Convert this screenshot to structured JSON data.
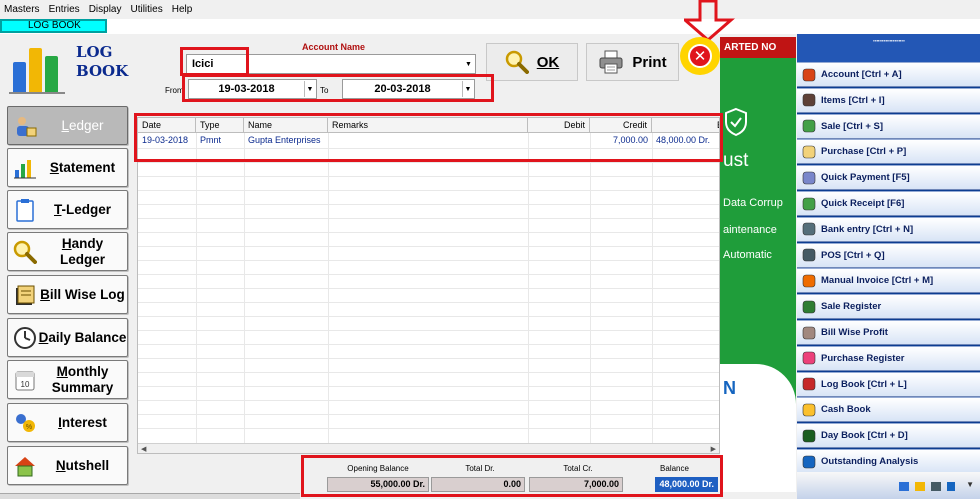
{
  "menu": [
    "Masters",
    "Entries",
    "Display",
    "Utilities",
    "Help"
  ],
  "window_tab": "LOG BOOK",
  "module": {
    "title_line1": "LOG",
    "title_line2": "BOOK"
  },
  "account": {
    "label": "Account Name",
    "value": "Icici"
  },
  "date_range": {
    "from_label": "From",
    "from_value": "19-03-2018",
    "to_label": "To",
    "to_value": "20-03-2018"
  },
  "buttons": {
    "ok": "OK",
    "print": "Print"
  },
  "nav": [
    {
      "label": "Ledger"
    },
    {
      "label": "Statement"
    },
    {
      "label": "T-Ledger"
    },
    {
      "label": "Handy Ledger"
    },
    {
      "label": "Bill Wise Log"
    },
    {
      "label": "Daily Balance"
    },
    {
      "label": "Monthly Summary"
    },
    {
      "label": "Interest"
    },
    {
      "label": "Nutshell"
    }
  ],
  "grid": {
    "columns": [
      "Date",
      "Type",
      "Name",
      "Remarks",
      "Debit",
      "Credit",
      "Balar"
    ],
    "rows": [
      {
        "date": "19-03-2018",
        "type": "Pmnt",
        "name": "Gupta Enterprises",
        "remarks": "",
        "debit": "",
        "credit": "7,000.00",
        "balance": "48,000.00 Dr."
      }
    ]
  },
  "totals": {
    "opening_label": "Opening Balance",
    "opening_value": "55,000.00 Dr.",
    "dr_label": "Total Dr.",
    "dr_value": "0.00",
    "cr_label": "Total Cr.",
    "cr_value": "7,000.00",
    "bal_label": "Balance",
    "bal_value": "48,000.00 Dr."
  },
  "background_ad": {
    "top": "ARTED NO",
    "lines": [
      "ust",
      "Data Corrup",
      "aintenance",
      "Automatic",
      "N"
    ]
  },
  "right_panel": {
    "items": [
      {
        "label": "Account [Ctrl + A]",
        "icon": "account-icon",
        "color": "#d84315"
      },
      {
        "label": "Items [Ctrl + I]",
        "icon": "items-icon",
        "color": "#5d4037"
      },
      {
        "label": "Sale [Ctrl + S]",
        "icon": "sale-icon",
        "color": "#43a047"
      },
      {
        "label": "Purchase [Ctrl + P]",
        "icon": "purchase-icon",
        "color": "#f2d27a"
      },
      {
        "label": "Quick Payment [F5]",
        "icon": "quick-payment-icon",
        "color": "#7986cb"
      },
      {
        "label": "Quick Receipt [F6]",
        "icon": "quick-receipt-icon",
        "color": "#43a047"
      },
      {
        "label": "Bank entry [Ctrl + N]",
        "icon": "bank-entry-icon",
        "color": "#546e7a"
      },
      {
        "label": "POS [Ctrl + Q]",
        "icon": "pos-icon",
        "color": "#455a64"
      },
      {
        "label": "Manual Invoice [Ctrl + M]",
        "icon": "manual-invoice-icon",
        "color": "#ef6c00"
      },
      {
        "label": "Sale Register",
        "icon": "sale-register-icon",
        "color": "#2e7d32"
      },
      {
        "label": "Bill Wise Profit",
        "icon": "bill-wise-profit-icon",
        "color": "#a1887f"
      },
      {
        "label": "Purchase Register",
        "icon": "purchase-register-icon",
        "color": "#ec407a"
      },
      {
        "label": "Log Book [Ctrl + L]",
        "icon": "log-book-icon",
        "color": "#c62828"
      },
      {
        "label": "Cash Book",
        "icon": "cash-book-icon",
        "color": "#fbc02d"
      },
      {
        "label": "Day Book [Ctrl + D]",
        "icon": "day-book-icon",
        "color": "#1b5e20"
      },
      {
        "label": "Outstanding Analysis",
        "icon": "outstanding-analysis-icon",
        "color": "#1565c0"
      }
    ]
  },
  "colors": {
    "highlight": "#e0141c",
    "brand_blue": "#0b2a8e",
    "panel": "#0d3d91"
  }
}
